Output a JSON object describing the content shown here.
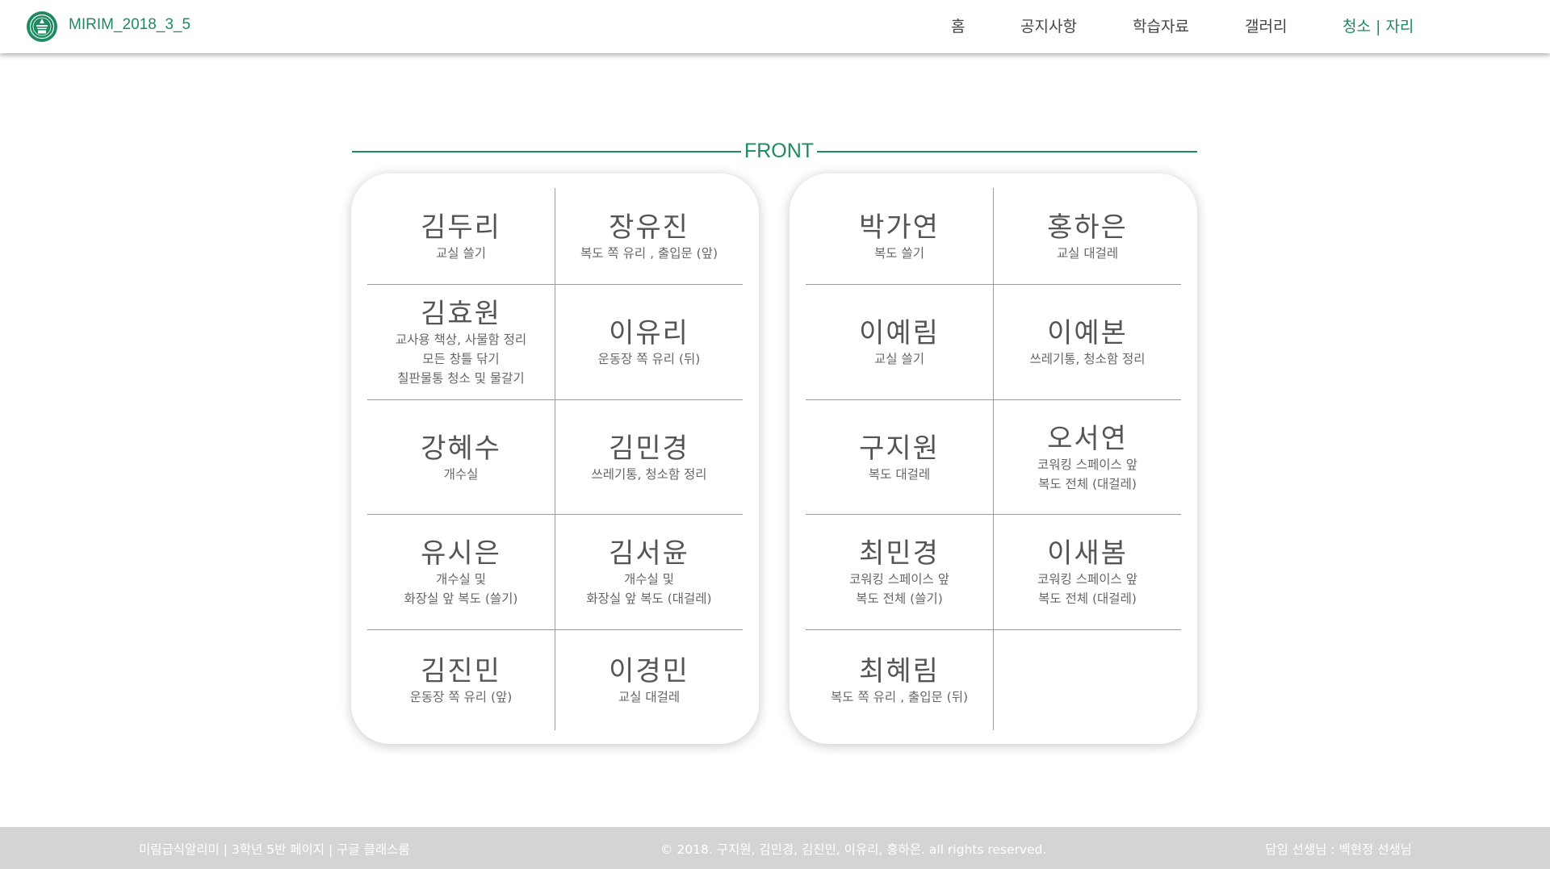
{
  "header": {
    "brand": "MIRIM_2018_3_5",
    "nav": [
      {
        "label": "홈",
        "active": false
      },
      {
        "label": "공지사항",
        "active": false
      },
      {
        "label": "학습자료",
        "active": false
      },
      {
        "label": "갤러리",
        "active": false
      },
      {
        "label": "청소 | 자리",
        "active": true
      }
    ]
  },
  "front_label": "FRONT",
  "boards": {
    "left": [
      {
        "name": "김두리",
        "duty": "교실 쓸기"
      },
      {
        "name": "장유진",
        "duty": "복도 쪽 유리 , 출입문 (앞)"
      },
      {
        "name": "김효원",
        "duty": "교사용 책상, 사물함 정리\n모든 창틀 닦기\n칠판물통 청소 및 물갈기"
      },
      {
        "name": "이유리",
        "duty": "운동장 쪽 유리 (뒤)"
      },
      {
        "name": "강혜수",
        "duty": "개수실"
      },
      {
        "name": "김민경",
        "duty": "쓰레기통, 청소함 정리"
      },
      {
        "name": "유시은",
        "duty": "개수실 및\n화장실 앞 복도 (쓸기)"
      },
      {
        "name": "김서윤",
        "duty": "개수실 및\n화장실 앞 복도 (대걸레)"
      },
      {
        "name": "김진민",
        "duty": "운동장 쪽 유리 (앞)"
      },
      {
        "name": "이경민",
        "duty": "교실 대걸레"
      }
    ],
    "right": [
      {
        "name": "박가연",
        "duty": "복도 쓸기"
      },
      {
        "name": "홍하은",
        "duty": "교실 대걸레"
      },
      {
        "name": "이예림",
        "duty": "교실 쓸기"
      },
      {
        "name": "이예본",
        "duty": "쓰레기통, 청소함 정리"
      },
      {
        "name": "구지원",
        "duty": "복도 대걸레"
      },
      {
        "name": "오서연",
        "duty": "코워킹 스페이스 앞\n복도 전체 (대걸레)"
      },
      {
        "name": "최민경",
        "duty": "코워킹 스페이스 앞\n복도 전체 (쓸기)"
      },
      {
        "name": "이새봄",
        "duty": "코워킹 스페이스 앞\n복도 전체 (대걸레)"
      },
      {
        "name": "최혜림",
        "duty": "복도 쪽 유리 , 출입문 (뒤)"
      },
      {
        "name": "",
        "duty": ""
      }
    ]
  },
  "footer": {
    "links": "미림급식알리미  |  3학년 5반 페이지  |  구글 클래스룸",
    "copyright": "© 2018. 구지원, 김민경, 김진민, 이유리, 홍하은. all rights reserved.",
    "teacher": "담임 선생님 : 백현정 선생님"
  },
  "colors": {
    "accent": "#1e8a5f",
    "footer_bg": "#d4d4d4"
  },
  "icons": {
    "logo": "school-emblem-icon"
  }
}
